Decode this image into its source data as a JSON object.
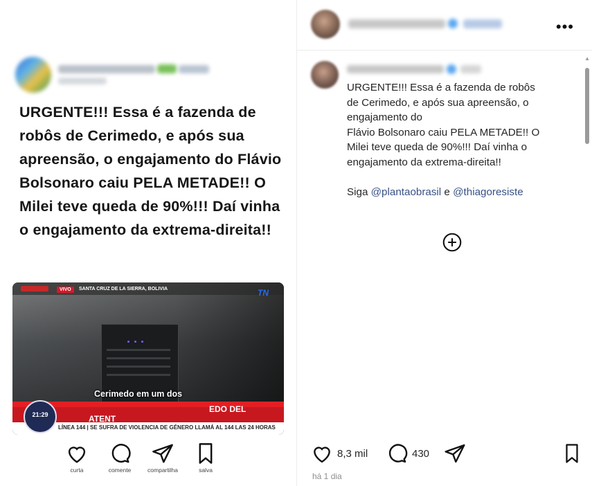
{
  "left_post": {
    "caption": "URGENTE!!! Essa é a fazenda de robôs de Cerimedo, e após sua apreensão, o engajamento do Flávio Bolsonaro caiu PELA METADE!! O Milei teve queda de 90%!!! Daí vinha o engajamento da extrema-direita!!",
    "video": {
      "live_badge": "VIVO",
      "location": "SANTA CRUZ DE LA SIERRA, BOLIVIA",
      "channel_logo": "TN",
      "subtitle": "Cerimedo em um dos",
      "lower_third_1": "EDO DEL",
      "lower_third_2": "ATENT",
      "clock_time": "21:29",
      "ticker": "LÍNEA 144 | SE SUFRA DE VIOLENCIA DE GÉNERO LLAMÁ AL 144 LAS 24 HORAS"
    },
    "actions": [
      {
        "icon": "heart-icon",
        "label": "curta"
      },
      {
        "icon": "comment-icon",
        "label": "comente"
      },
      {
        "icon": "share-icon",
        "label": "compartilha"
      },
      {
        "icon": "bookmark-icon",
        "label": "salva"
      }
    ]
  },
  "right_post": {
    "more_label": "•••",
    "caption_lines": [
      "URGENTE!!! Essa é a fazenda de robôs",
      "de Cerimedo, e após sua apreensão, o",
      "engajamento do",
      "Flávio Bolsonaro caiu PELA METADE!! O",
      "Milei teve queda de 90%!!! Daí vinha o",
      "engajamento da extrema-direita!!"
    ],
    "follow_prefix": "Siga",
    "mention_1": "@plantaobrasil",
    "follow_join": "e",
    "mention_2": "@thiagoresiste",
    "likes": "8,3 mil",
    "comments": "430",
    "timestamp": "há 1 dia"
  },
  "colors": {
    "accent_red": "#e31f24",
    "mention_blue": "#385185",
    "text": "#262626"
  }
}
